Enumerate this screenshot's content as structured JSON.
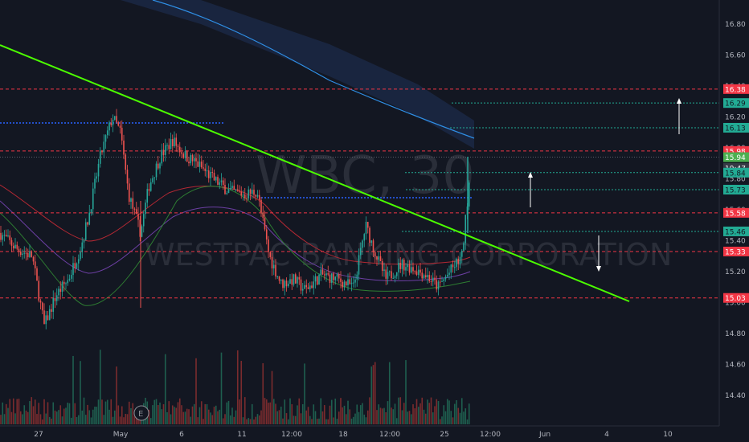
{
  "chart_data": {
    "type": "candlestick",
    "title": "",
    "watermark": {
      "ticker": "WBC, 30",
      "name": "WESTPAC BANKING CORPORATION"
    },
    "ylim": [
      14.25,
      16.95
    ],
    "y_ticks": [
      14.4,
      14.6,
      14.8,
      15.0,
      15.2,
      15.4,
      15.6,
      15.8,
      16.0,
      16.2,
      16.4,
      16.6,
      16.8
    ],
    "y_ticks_text": [
      "14.40",
      "14.60",
      "14.80",
      "15.00",
      "15.20",
      "15.40",
      "15.60",
      "15.80",
      "16.00",
      "16.20",
      "16.40",
      "16.60",
      "16.80"
    ],
    "x_ticks": [
      "27",
      "May",
      "6",
      "11",
      "12:00",
      "18",
      "12:00",
      "25",
      "12:00",
      "Jun",
      "4",
      "10"
    ],
    "price_levels": [
      {
        "label": "16.38",
        "value": 16.38,
        "color": "#f23645",
        "style": "dashed"
      },
      {
        "label": "16.29",
        "value": 16.29,
        "color": "#22ab94",
        "style": "dotted"
      },
      {
        "label": "16.13",
        "value": 16.13,
        "color": "#22ab94",
        "style": "dotted"
      },
      {
        "label": "15.98",
        "value": 15.98,
        "color": "#f23645",
        "style": "dashed"
      },
      {
        "label": "15.94",
        "value": 15.94,
        "color": "#4caf50",
        "style": "solid"
      },
      {
        "label": "19:47",
        "value": 15.87,
        "color": "#363a45",
        "style": "none"
      },
      {
        "label": "15.84",
        "value": 15.84,
        "color": "#22ab94",
        "style": "dotted"
      },
      {
        "label": "15.73",
        "value": 15.73,
        "color": "#22ab94",
        "style": "dotted"
      },
      {
        "label": "15.58",
        "value": 15.58,
        "color": "#f23645",
        "style": "dashed"
      },
      {
        "label": "15.46",
        "value": 15.46,
        "color": "#22ab94",
        "style": "dotted"
      },
      {
        "label": "15.33",
        "value": 15.33,
        "color": "#f23645",
        "style": "dashed"
      },
      {
        "label": "15.03",
        "value": 15.03,
        "color": "#f23645",
        "style": "dashed"
      }
    ],
    "trendline": {
      "from": [
        0,
        16.7
      ],
      "to": [
        783,
        15.0
      ],
      "color": "#4cff00"
    },
    "blue_levels": [
      16.13,
      15.74
    ],
    "colors": {
      "up": "#26a69a",
      "down": "#ef5350",
      "background": "#131722",
      "axis_text": "#b2b5be"
    }
  }
}
